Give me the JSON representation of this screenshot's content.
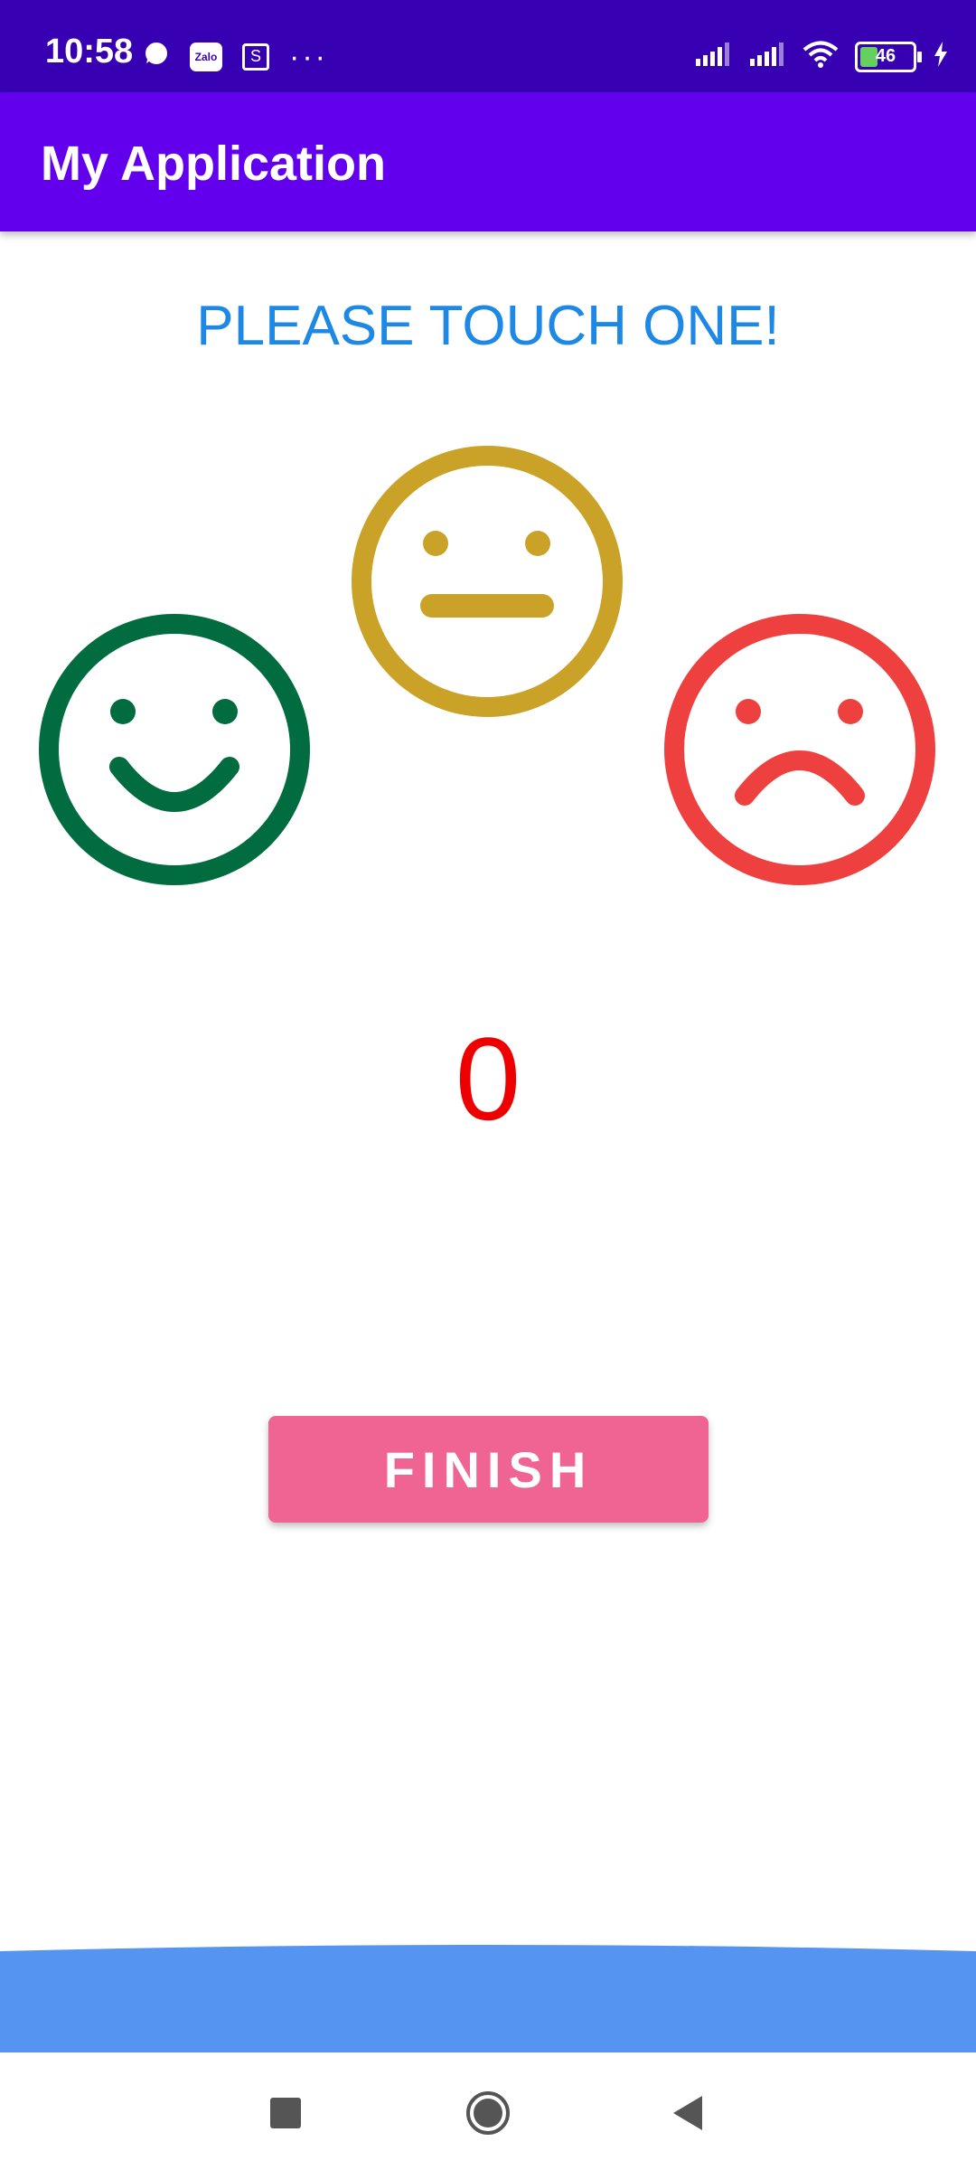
{
  "status_bar": {
    "time": "10:58",
    "notification_icons": [
      "chat-bubble-icon",
      "zalo-icon",
      "s-app-icon",
      "more-dots-icon"
    ],
    "zalo_label": "Zalo",
    "s_label": "S",
    "more": "···",
    "battery_level": "46"
  },
  "app_bar": {
    "title": "My Application"
  },
  "prompt": {
    "text": "PLEASE TOUCH ONE!",
    "color": "#1e88e5"
  },
  "faces": [
    {
      "name": "happy",
      "color": "#006c3f"
    },
    {
      "name": "neutral",
      "color": "#c9a227"
    },
    {
      "name": "sad",
      "color": "#ef4040"
    }
  ],
  "counter": {
    "value": "0",
    "color": "#ee0000"
  },
  "finish_button": {
    "label": "FINISH",
    "color": "#f06493"
  },
  "colors": {
    "status_bar": "#3700b3",
    "app_bar": "#6200ee",
    "bottom_banner": "#5594f0"
  },
  "nav_bar": {
    "buttons": [
      "recents-square-icon",
      "home-circle-icon",
      "back-triangle-icon"
    ]
  }
}
